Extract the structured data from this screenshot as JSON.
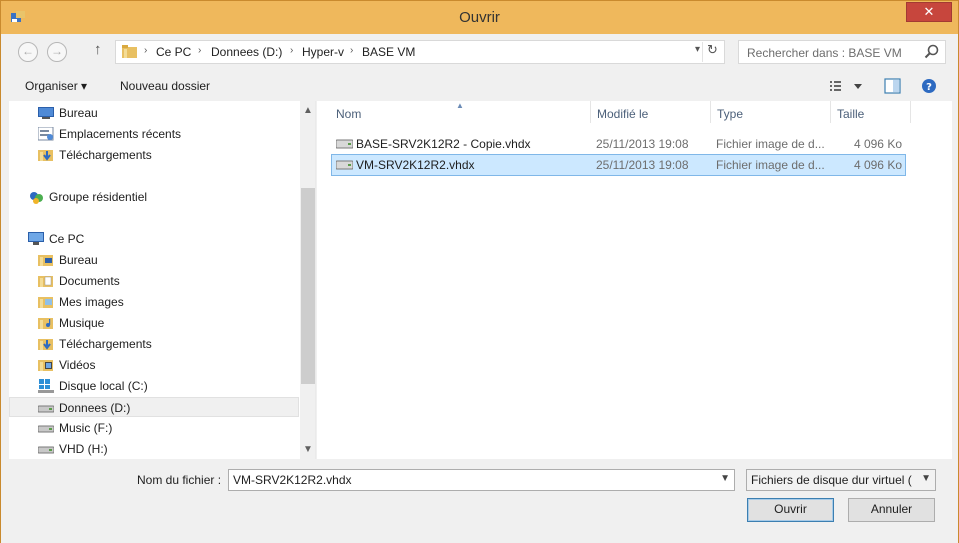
{
  "window": {
    "title": "Ouvrir",
    "close_label": "✕"
  },
  "nav": {
    "back_glyph": "←",
    "forward_glyph": "→",
    "up_glyph": "↑",
    "breadcrumb": [
      "Ce PC",
      "Donnees (D:)",
      "Hyper-v",
      "BASE VM"
    ],
    "separator": "›",
    "search_placeholder": "Rechercher dans : BASE VM"
  },
  "toolbar": {
    "organize_label": "Organiser ▾",
    "new_folder_label": "Nouveau dossier"
  },
  "sidebar": {
    "items": [
      {
        "label": "Bureau",
        "icon": "desktop-icon"
      },
      {
        "label": "Emplacements récents",
        "icon": "recent-places-icon"
      },
      {
        "label": "Téléchargements",
        "icon": "downloads-folder-icon"
      },
      {
        "label": "Groupe résidentiel",
        "icon": "homegroup-icon"
      },
      {
        "label": "Ce PC",
        "icon": "computer-icon"
      },
      {
        "label": "Bureau",
        "icon": "desktop-folder-icon"
      },
      {
        "label": "Documents",
        "icon": "documents-folder-icon"
      },
      {
        "label": "Mes images",
        "icon": "pictures-folder-icon"
      },
      {
        "label": "Musique",
        "icon": "music-folder-icon"
      },
      {
        "label": "Téléchargements",
        "icon": "downloads-folder-icon"
      },
      {
        "label": "Vidéos",
        "icon": "videos-folder-icon"
      },
      {
        "label": "Disque local (C:)",
        "icon": "windows-drive-icon"
      },
      {
        "label": "Donnees (D:)",
        "icon": "drive-icon"
      },
      {
        "label": "Music (F:)",
        "icon": "drive-icon"
      },
      {
        "label": "VHD (H:)",
        "icon": "drive-icon"
      }
    ]
  },
  "columns": {
    "name": "Nom",
    "modified": "Modifié le",
    "type": "Type",
    "size": "Taille"
  },
  "files": [
    {
      "name": "BASE-SRV2K12R2 - Copie.vhdx",
      "modified": "25/11/2013 19:08",
      "type": "Fichier image de d...",
      "size": "4 096 Ko"
    },
    {
      "name": "VM-SRV2K12R2.vhdx",
      "modified": "25/11/2013 19:08",
      "type": "Fichier image de d...",
      "size": "4 096 Ko"
    }
  ],
  "footer": {
    "filename_label": "Nom du fichier :",
    "filename_value": "VM-SRV2K12R2.vhdx",
    "filter_value": "Fichiers de disque dur virtuel  (",
    "open_label": "Ouvrir",
    "cancel_label": "Annuler"
  }
}
